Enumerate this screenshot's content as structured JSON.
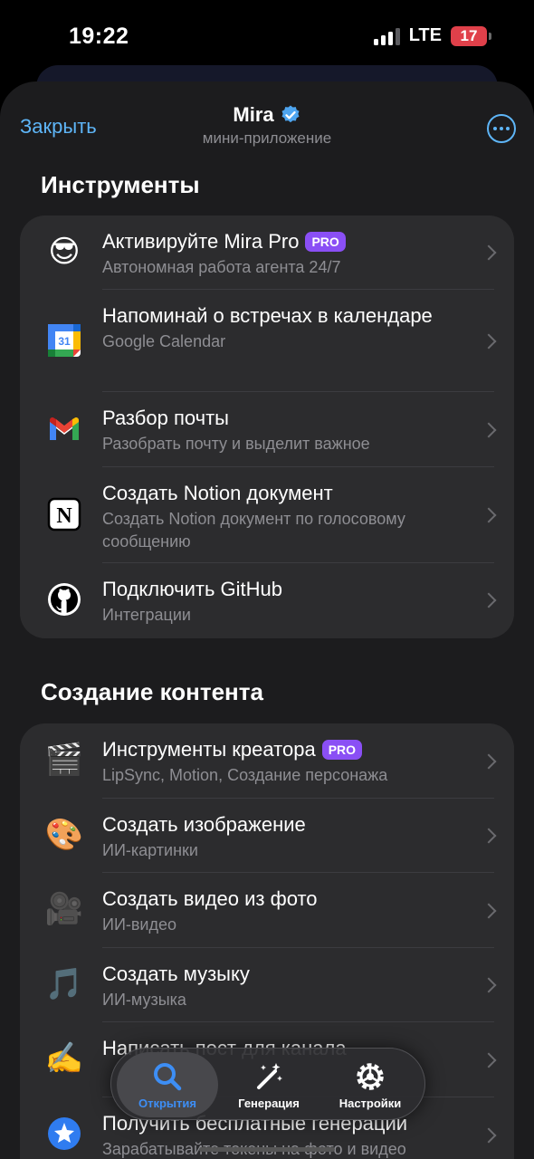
{
  "status_bar": {
    "time": "19:22",
    "network": "LTE",
    "battery": "17"
  },
  "header": {
    "close_label": "Закрыть",
    "title": "Mira",
    "subtitle": "мини-приложение"
  },
  "sections": [
    {
      "title": "Инструменты",
      "items": [
        {
          "icon": "sunglasses-emoji-icon",
          "glyph": "😎",
          "title": "Активируйте Mira Pro",
          "badge": "PRO",
          "subtitle": "Автономная работа агента 24/7"
        },
        {
          "icon": "google-calendar-icon",
          "title": "Напоминай о встречах в календаре",
          "subtitle": "Google Calendar"
        },
        {
          "icon": "gmail-icon",
          "title": "Разбор почты",
          "subtitle": "Разобрать почту и выделит важное"
        },
        {
          "icon": "notion-icon",
          "title": "Создать Notion документ",
          "subtitle": "Создать Notion документ по голосовому сообщению"
        },
        {
          "icon": "github-icon",
          "title": "Подключить GitHub",
          "subtitle": "Интеграции"
        }
      ]
    },
    {
      "title": "Создание контента",
      "items": [
        {
          "icon": "clapper-board-icon",
          "glyph": "🎬",
          "title": "Инструменты креатора",
          "badge": "PRO",
          "subtitle": "LipSync, Motion, Создание персонажа"
        },
        {
          "icon": "artist-palette-icon",
          "glyph": "🎨",
          "title": "Создать изображение",
          "subtitle": "ИИ-картинки"
        },
        {
          "icon": "movie-camera-icon",
          "glyph": "🎥",
          "title": "Создать видео из фото",
          "subtitle": "ИИ-видео"
        },
        {
          "icon": "musical-notes-icon",
          "glyph": "🎵",
          "title": "Создать музыку",
          "subtitle": "ИИ-музыка"
        },
        {
          "icon": "writing-hand-icon",
          "glyph": "✍️",
          "title": "Написать пост для канала",
          "subtitle": ""
        },
        {
          "icon": "star-badge-icon",
          "title": "Получить бесплатные генерации",
          "subtitle": "Зарабатывайте токены на фото и видео"
        }
      ]
    }
  ],
  "tabbar": {
    "tabs": [
      {
        "label": "Открытия",
        "icon": "search-icon",
        "active": true
      },
      {
        "label": "Генерация",
        "icon": "magic-wand-icon",
        "active": false
      },
      {
        "label": "Настройки",
        "icon": "gear-icon",
        "active": false
      }
    ]
  },
  "colors": {
    "accent": "#5eb5f7",
    "pro_badge": "#8a4ff5",
    "active_tab": "#3d8ef5"
  }
}
